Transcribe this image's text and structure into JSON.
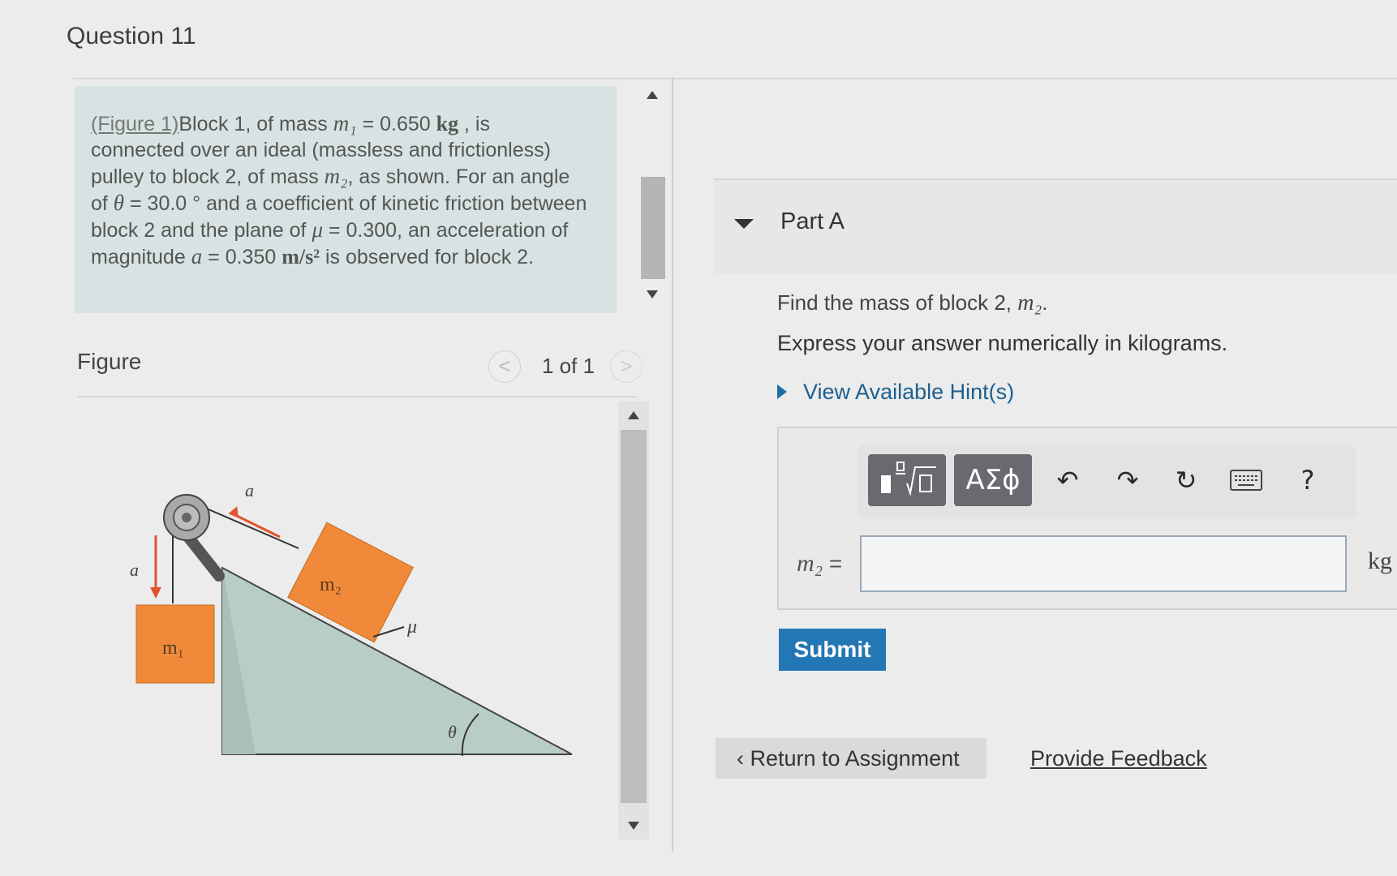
{
  "question": {
    "title": "Question 11"
  },
  "problem": {
    "figure_link": "(Figure 1)",
    "lines": [
      "Block 1, of mass",
      "m₁",
      " = 0.650 ",
      "kg",
      " , is",
      "connected over an ideal (massless and frictionless)",
      "pulley to block 2, of mass ",
      "m₂",
      ", as shown. For an angle",
      "of ",
      "θ",
      " = 30.0 ° and a coefficient of kinetic friction between",
      "block 2 and the plane of ",
      "μ",
      " = 0.300, an acceleration of",
      "magnitude ",
      "a",
      " = 0.350 ",
      "m/s²",
      " is observed for block 2."
    ]
  },
  "figure": {
    "label": "Figure",
    "prev": "<",
    "counter": "1 of 1",
    "next": ">",
    "labels": {
      "m1": "m₁",
      "m2": "m₂",
      "a_left": "a⃗",
      "a_incline": "a⃗",
      "mu": "μ",
      "theta": "θ"
    },
    "colors": {
      "block": "#f08a3a",
      "incline": "#b9cdc8",
      "arrow": "#e2532d"
    }
  },
  "part": {
    "title": "Part A",
    "question": "Find the mass of block 2, ",
    "question_var": "m₂",
    "question_end": ".",
    "instruction": "Express your answer numerically in kilograms.",
    "hint": "View Available Hint(s)"
  },
  "toolbar": {
    "symbols_label": "ΑΣϕ",
    "undo_icon": "↶",
    "redo_icon": "↷",
    "reset_icon": "↻",
    "help_label": "?"
  },
  "answer": {
    "label_var": "m₂",
    "label_eq": " =",
    "value": "",
    "unit": "kg"
  },
  "actions": {
    "submit": "Submit",
    "return": "Return to Assignment",
    "return_icon": "‹",
    "feedback": "Provide Feedback"
  }
}
